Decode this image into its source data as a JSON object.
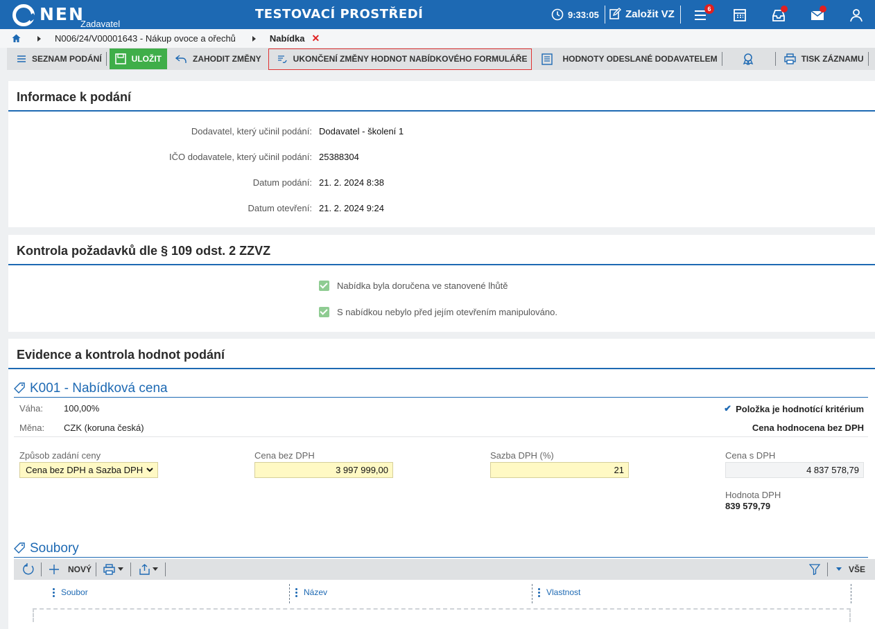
{
  "topbar": {
    "logo_text": "NEN",
    "logo_sub": "Zadavatel",
    "env_title": "TESTOVACÍ PROSTŘEDÍ",
    "time": "9:33:05",
    "zalozit_label": "Založit VZ",
    "menu_badge": "6",
    "colors": {
      "bar": "#1d69b3",
      "badge": "#e02020"
    }
  },
  "breadcrumb": {
    "item1": "N006/24/V00001643 - Nákup ovoce a ořechů",
    "item2": "Nabídka"
  },
  "toolbar": {
    "seznam": "SEZNAM PODÁNÍ",
    "ulozit": "ULOŽIT",
    "zahodit": "ZAHODIT ZMĚNY",
    "ukonceni": "UKONČENÍ ZMĚNY HODNOT NABÍDKOVÉHO FORMULÁŘE",
    "hodnoty": "HODNOTY ODESLANÉ DODAVATELEM",
    "tisk": "TISK ZÁZNAMU"
  },
  "info": {
    "title": "Informace k podání",
    "rows": [
      {
        "label": "Dodavatel, který učinil podání:",
        "value": "Dodavatel - školení 1"
      },
      {
        "label": "IČO dodavatele, který učinil podání:",
        "value": "25388304"
      },
      {
        "label": "Datum podání:",
        "value": "21. 2. 2024 8:38"
      },
      {
        "label": "Datum otevření:",
        "value": "21. 2. 2024 9:24"
      }
    ]
  },
  "kontrola": {
    "title": "Kontrola požadavků dle § 109 odst. 2 ZZVZ",
    "checks": [
      "Nabídka byla doručena ve stanovené lhůtě",
      "S nabídkou nebylo před jejím otevřením manipulováno."
    ]
  },
  "evidence": {
    "title": "Evidence a kontrola hodnot podání",
    "k001": {
      "heading": "K001 - Nabídková cena",
      "vaha_label": "Váha:",
      "vaha_value": "100,00%",
      "mena_label": "Měna:",
      "mena_value": "CZK (koruna česká)",
      "kriterium": "Položka je hodnotící kritérium",
      "hodnoceni": "Cena hodnocena bez DPH",
      "zpusob_label": "Způsob zadání ceny",
      "zpusob_value": "Cena bez DPH a Sazba DPH",
      "cena_bez_label": "Cena bez DPH",
      "cena_bez_value": "3 997 999,00",
      "sazba_label": "Sazba DPH (%)",
      "sazba_value": "21",
      "cena_s_label": "Cena s DPH",
      "cena_s_value": "4 837 578,79",
      "hodnota_label": "Hodnota DPH",
      "hodnota_value": "839 579,79"
    },
    "soubory": {
      "heading": "Soubory",
      "novy": "NOVÝ",
      "vse": "VŠE",
      "columns": [
        "Soubor",
        "Název",
        "Vlastnost"
      ]
    }
  }
}
